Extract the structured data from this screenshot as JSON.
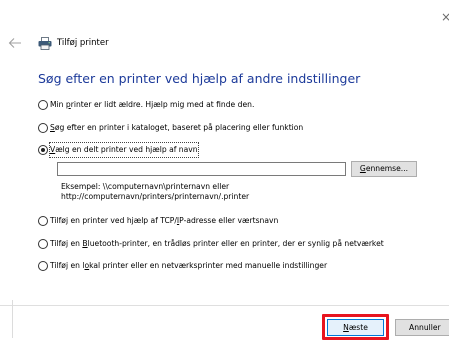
{
  "window": {
    "close_glyph": "×",
    "title": "Tilføj printer",
    "back_icon": "back-arrow-icon",
    "printer_icon": "printer-icon"
  },
  "heading": "Søg efter en printer ved hjælp af andre indstillinger",
  "options": [
    {
      "pre": "Min ",
      "key": "p",
      "post": "rinter er lidt ældre. Hjælp mig med at finde den.",
      "checked": false
    },
    {
      "pre": "",
      "key": "S",
      "post": "øg efter en printer i kataloget, baseret på placering eller funktion",
      "checked": false
    },
    {
      "pre": "",
      "key": "V",
      "post": "ælg en delt printer ved hjælp af navn",
      "checked": true
    },
    {
      "pre": "Tilføj en printer ved hjælp af TCP/",
      "key": "I",
      "post": "P-adresse eller værtsnavn",
      "checked": false
    },
    {
      "pre": "Tilføj en ",
      "key": "B",
      "post": "luetooth-printer, en trådløs printer eller en printer, der er synlig på netværket",
      "checked": false
    },
    {
      "pre": "Tilføj en l",
      "key": "o",
      "post": "kal printer eller en netværksprinter med manuelle indstillinger",
      "checked": false
    }
  ],
  "printer_name": {
    "value": "",
    "browse_key": "G",
    "browse_rest": "ennemse..."
  },
  "example": {
    "line1": "Eksempel: \\\\computernavn\\printernavn eller",
    "line2": "http://computernavn/printers/printernavn/.printer"
  },
  "footer": {
    "next_key": "N",
    "next_rest": "æste",
    "cancel_label": "Annuller",
    "highlight_color": "#e8151f"
  }
}
